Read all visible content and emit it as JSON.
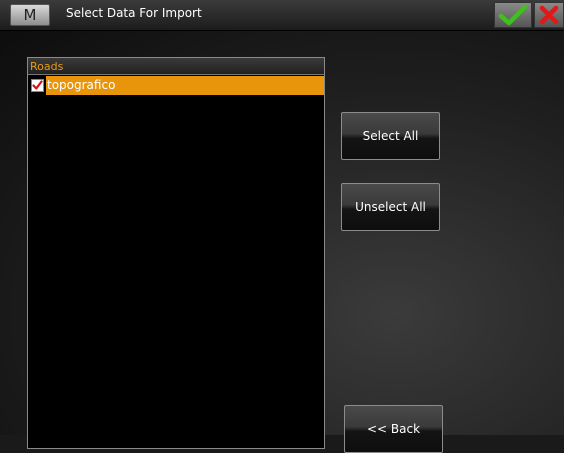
{
  "window": {
    "menu_button_label": "M",
    "title": "Select Data For Import"
  },
  "icons": {
    "ok": "check-icon",
    "cancel": "close-icon"
  },
  "colors": {
    "accent": "#e8950c",
    "ok_green": "#3ec11c",
    "cancel_red": "#e01818"
  },
  "list": {
    "header": "Roads",
    "items": [
      {
        "label": "topografico",
        "checked": true,
        "selected": true
      }
    ]
  },
  "buttons": {
    "select_all": "Select All",
    "unselect_all": "Unselect All",
    "back": "<< Back"
  }
}
